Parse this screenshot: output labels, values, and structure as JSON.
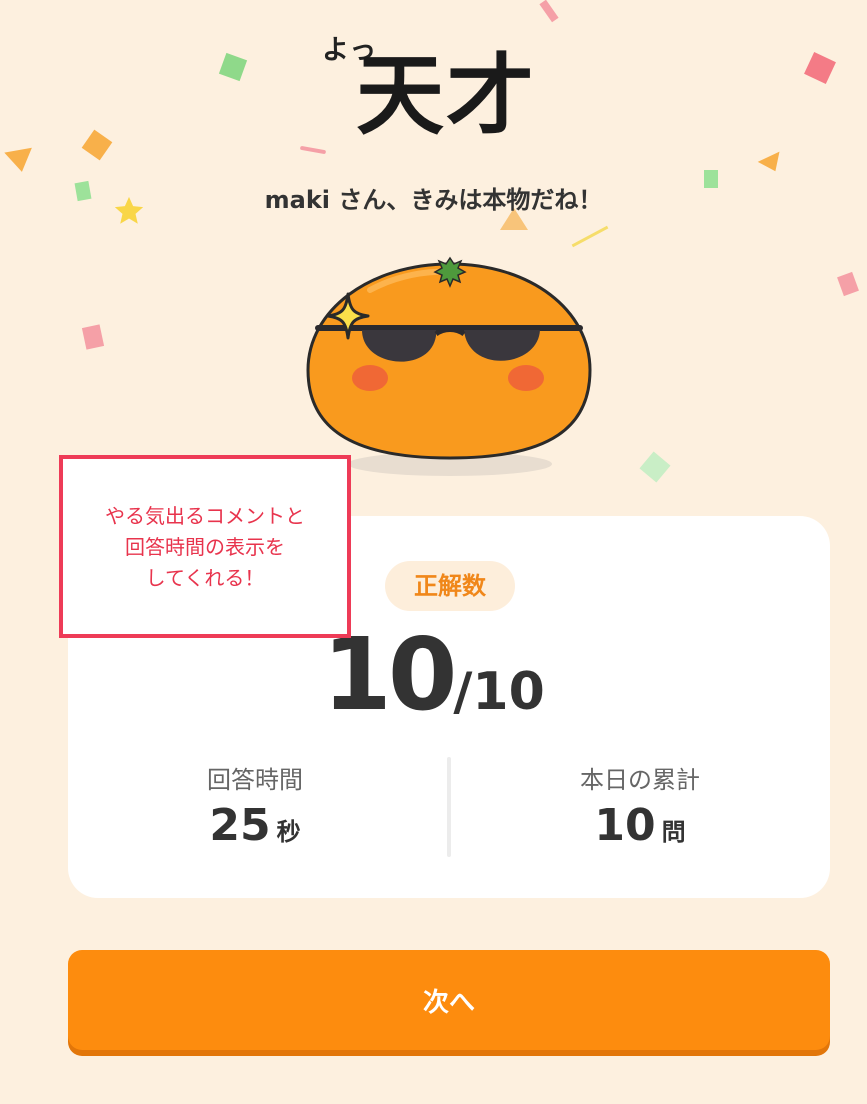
{
  "header": {
    "ruby": "よっ",
    "rank_title": "天才",
    "message": "maki さん、きみは本物だね！"
  },
  "mascot": {
    "icon": "sunglasses-mandarin-mascot-icon"
  },
  "result_card": {
    "badge_label": "正解数",
    "score_correct": "10",
    "score_total": "/10",
    "answer_time": {
      "label": "回答時間",
      "value": "25",
      "unit": "秒"
    },
    "daily_total": {
      "label": "本日の累計",
      "value": "10",
      "unit": "問"
    }
  },
  "next_button": {
    "label": "次へ"
  },
  "annotation": {
    "text": "やる気出るコメントと\n回答時間の表示を\nしてくれる！"
  },
  "colors": {
    "background": "#fdf0df",
    "accent_orange": "#fd8c0e",
    "badge_text": "#f0871a",
    "annotation_red": "#ee3b57"
  }
}
